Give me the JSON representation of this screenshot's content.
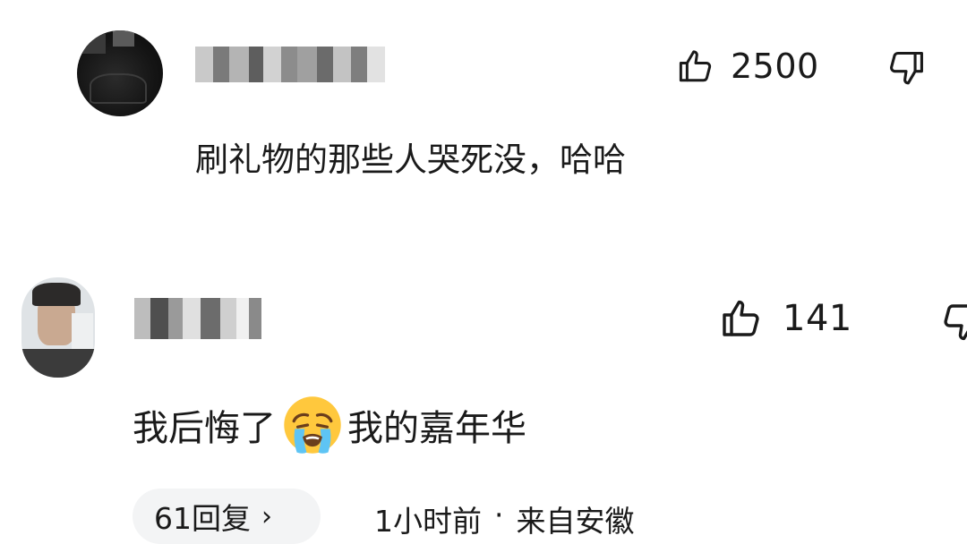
{
  "comments": [
    {
      "author": "",
      "text": "刷礼物的那些人哭死没，哈哈",
      "like_count": "2500",
      "icons": {
        "like": "thumbs-up-icon",
        "dislike": "thumbs-down-icon"
      }
    },
    {
      "author": "",
      "text_before": "我后悔了",
      "emoji": "loudly-crying-face-emoji",
      "text_after": "我的嘉年华",
      "like_count": "141",
      "reply_label": "61回复",
      "reply_chevron": "›",
      "time": "1小时前",
      "separator": "·",
      "location": "来自安徽",
      "icons": {
        "like": "thumbs-up-icon",
        "dislike": "thumbs-down-icon"
      }
    }
  ]
}
